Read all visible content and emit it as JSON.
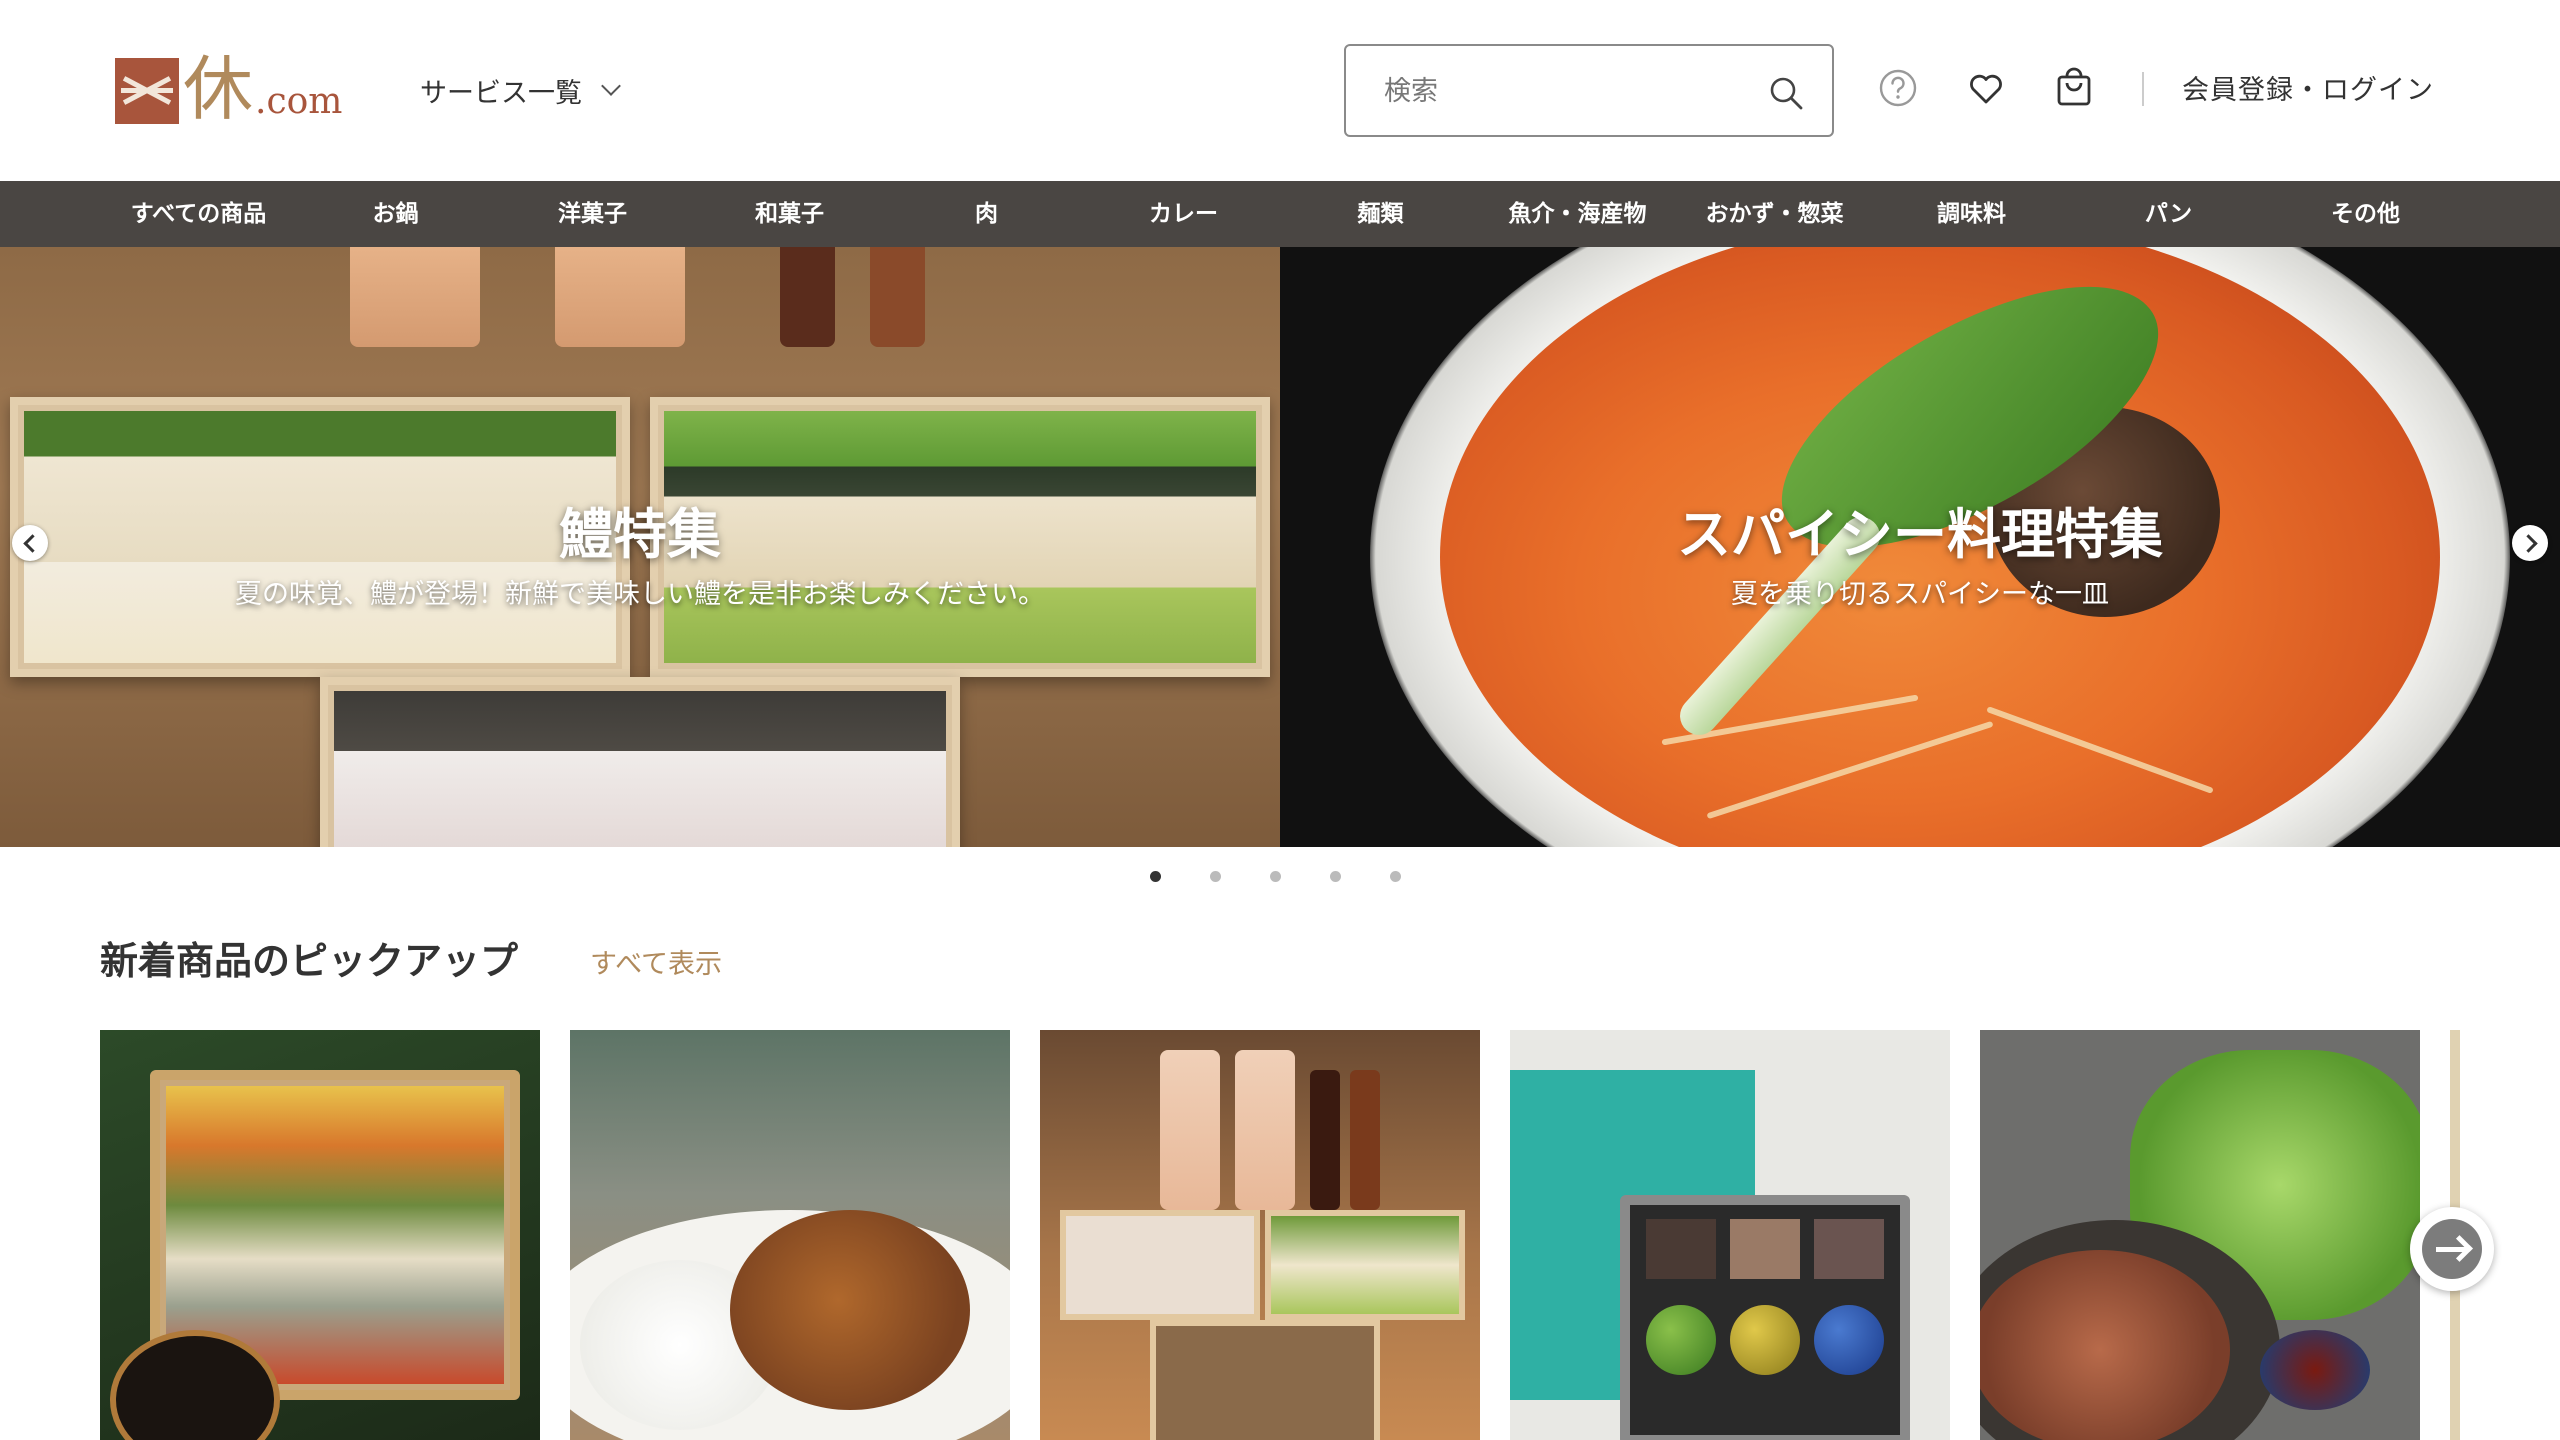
{
  "header": {
    "logo_main": "休",
    "logo_suffix": ".com",
    "services_label": "サービス一覧",
    "search_placeholder": "検索",
    "login_label": "会員登録・ログイン",
    "icons": [
      "help-icon",
      "heart-icon",
      "cart-icon",
      "search-icon"
    ]
  },
  "categories": [
    "すべての商品",
    "お鍋",
    "洋菓子",
    "和菓子",
    "肉",
    "カレー",
    "麺類",
    "魚介・海産物",
    "おかず・惣菜",
    "調味料",
    "パン",
    "その他"
  ],
  "hero": {
    "slides": [
      {
        "title": "鱧特集",
        "subtitle": "夏の味覚、鱧が登場！新鮮で美味しい鱧を是非お楽しみください。"
      },
      {
        "title": "スパイシー料理特集",
        "subtitle": "夏を乗り切るスパイシーな一皿"
      }
    ],
    "dot_count": 5,
    "active_dot": 1
  },
  "section": {
    "title": "新着商品のピックアップ",
    "link": "すべて表示"
  },
  "colors": {
    "accent": "#b08a5c",
    "brand": "#a8553c",
    "nav_bg": "#4a4643"
  }
}
